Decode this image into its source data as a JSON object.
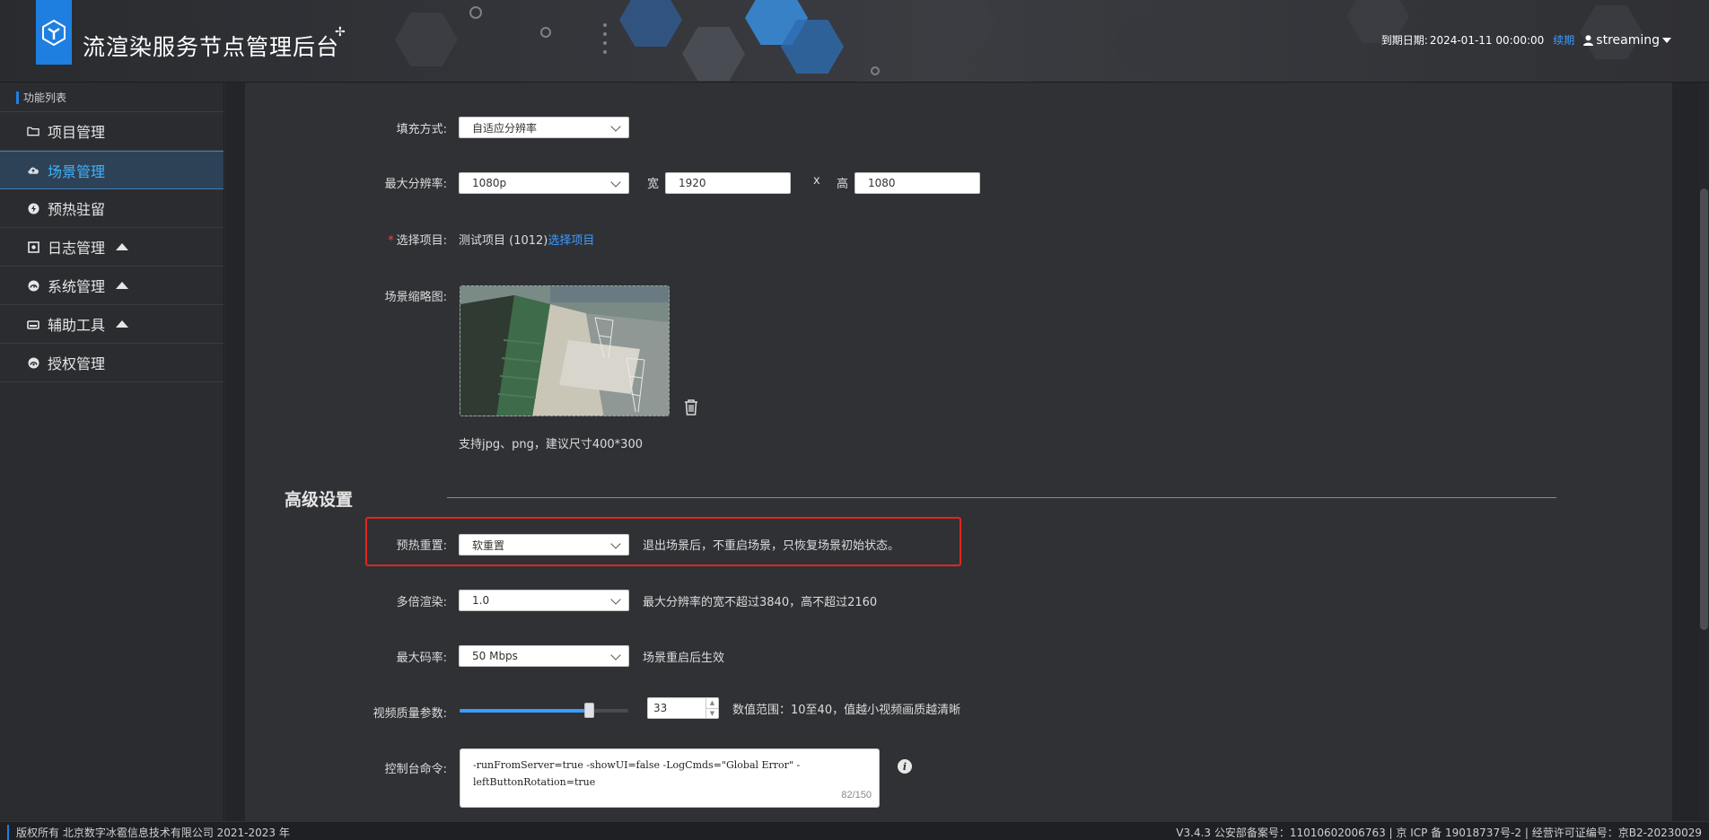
{
  "header": {
    "app_title": "流渲染服务节点管理后台",
    "title_mark": "✢",
    "expiry_label": "到期日期:",
    "expiry_date": "2024-01-11 00:00:00",
    "renew_label": "续期",
    "username": "streaming"
  },
  "sidebar": {
    "caption": "功能列表",
    "items": [
      {
        "label": "项目管理",
        "icon": "folder-icon"
      },
      {
        "label": "场景管理",
        "icon": "cloud-icon"
      },
      {
        "label": "预热驻留",
        "icon": "bolt-icon"
      },
      {
        "label": "日志管理",
        "icon": "log-icon"
      },
      {
        "label": "系统管理",
        "icon": "gauge-icon"
      },
      {
        "label": "辅助工具",
        "icon": "tool-icon"
      },
      {
        "label": "授权管理",
        "icon": "license-icon"
      }
    ]
  },
  "form": {
    "fill_mode": {
      "label": "填充方式:",
      "value": "自适应分辨率"
    },
    "max_resolution": {
      "label": "最大分辨率:",
      "value": "1080p",
      "width_label": "宽",
      "width_value": "1920",
      "times": "x",
      "height_label": "高",
      "height_value": "1080"
    },
    "project": {
      "required_mark": "*",
      "label": "选择项目:",
      "value": "测试项目 (1012)",
      "link": "选择项目"
    },
    "thumbnail": {
      "label": "场景缩略图:",
      "hint": "支持jpg、png，建议尺寸400*300"
    },
    "advanced_title": "高级设置",
    "warm_reset": {
      "label": "预热重置:",
      "value": "软重置",
      "hint": "退出场景后，不重启场景，只恢复场景初始状态。"
    },
    "multi_render": {
      "label": "多倍渲染:",
      "value": "1.0",
      "hint": "最大分辨率的宽不超过3840，高不超过2160"
    },
    "max_bitrate": {
      "label": "最大码率:",
      "value": "50 Mbps",
      "hint": "场景重启后生效"
    },
    "video_quality": {
      "label": "视频质量参数:",
      "value": "33",
      "range_min": 10,
      "range_max": 40,
      "hint": "数值范围：10至40，值越小视频画质越清晰"
    },
    "console_cmd": {
      "label": "控制台命令:",
      "value": "-runFromServer=true -showUI=false -LogCmds=\"Global Error\" -leftButtonRotation=true",
      "counter": "82/150"
    }
  },
  "footer": {
    "left": "版权所有 北京数字冰雹信息技术有限公司 2021-2023 年",
    "right": "V3.4.3 公安部备案号：11010602006763 | 京 ICP 备 19018737号-2 | 经营许可证编号：京B2-20230029"
  },
  "colors": {
    "accent": "#1f7fe0",
    "link": "#3d9bff",
    "highlight": "#e0261e",
    "active_nav_text": "#3fb3ff"
  }
}
